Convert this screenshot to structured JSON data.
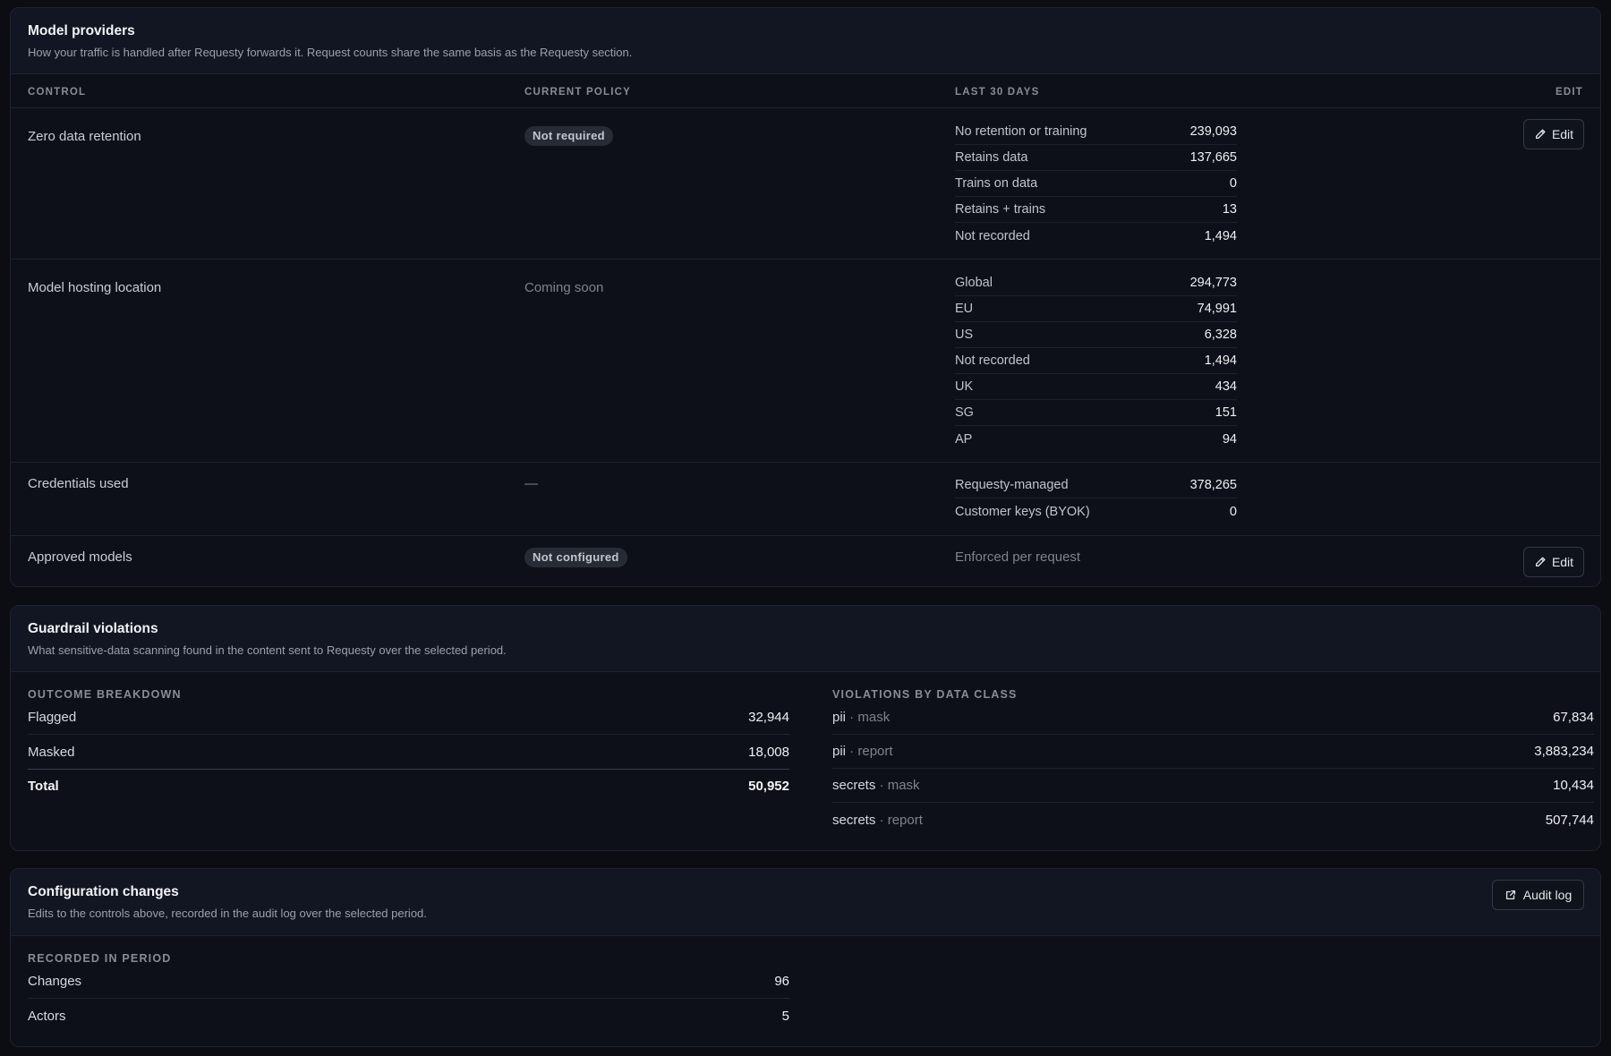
{
  "model_providers": {
    "title": "Model providers",
    "subtitle": "How your traffic is handled after Requesty forwards it. Request counts share the same basis as the Requesty section.",
    "columns": [
      "CONTROL",
      "CURRENT POLICY",
      "LAST 30 DAYS",
      "EDIT"
    ],
    "rows": [
      {
        "control": "Zero data retention",
        "policy": "Not required",
        "stats": [
          {
            "name": "No retention or training",
            "value": "239,093"
          },
          {
            "name": "Retains data",
            "value": "137,665"
          },
          {
            "name": "Trains on data",
            "value": "0"
          },
          {
            "name": "Retains + trains",
            "value": "13"
          },
          {
            "name": "Not recorded",
            "value": "1,494"
          }
        ],
        "edit_label": "Edit"
      },
      {
        "control": "Model hosting location",
        "policy": "Coming soon",
        "stats": [
          {
            "name": "Global",
            "value": "294,773"
          },
          {
            "name": "EU",
            "value": "74,991"
          },
          {
            "name": "US",
            "value": "6,328"
          },
          {
            "name": "Not recorded",
            "value": "1,494"
          },
          {
            "name": "UK",
            "value": "434"
          },
          {
            "name": "SG",
            "value": "151"
          },
          {
            "name": "AP",
            "value": "94"
          }
        ]
      },
      {
        "control": "Credentials used",
        "policy": "—",
        "stats": [
          {
            "name": "Requesty-managed",
            "value": "378,265"
          },
          {
            "name": "Customer keys (BYOK)",
            "value": "0"
          }
        ]
      },
      {
        "control": "Approved models",
        "policy": "Not configured",
        "note": "Enforced per request",
        "edit_label": "Edit"
      }
    ]
  },
  "guardrails": {
    "title": "Guardrail violations",
    "subtitle": "What sensitive-data scanning found in the content sent to Requesty over the selected period.",
    "outcome_label": "OUTCOME BREAKDOWN",
    "outcomes": [
      {
        "name": "Flagged",
        "value": "32,944"
      },
      {
        "name": "Masked",
        "value": "18,008"
      },
      {
        "name": "Total",
        "value": "50,952"
      }
    ],
    "class_label": "VIOLATIONS BY DATA CLASS",
    "classes": [
      {
        "cls": "pii",
        "sep": " · ",
        "action": "mask",
        "value": "67,834"
      },
      {
        "cls": "pii",
        "sep": " · ",
        "action": "report",
        "value": "3,883,234"
      },
      {
        "cls": "secrets",
        "sep": " · ",
        "action": "mask",
        "value": "10,434"
      },
      {
        "cls": "secrets",
        "sep": " · ",
        "action": "report",
        "value": "507,744"
      }
    ]
  },
  "config_changes": {
    "title": "Configuration changes",
    "subtitle": "Edits to the controls above, recorded in the audit log over the selected period.",
    "audit_label": "Audit log",
    "period_label": "RECORDED IN PERIOD",
    "items": [
      {
        "name": "Changes",
        "value": "96"
      },
      {
        "name": "Actors",
        "value": "5"
      }
    ]
  }
}
